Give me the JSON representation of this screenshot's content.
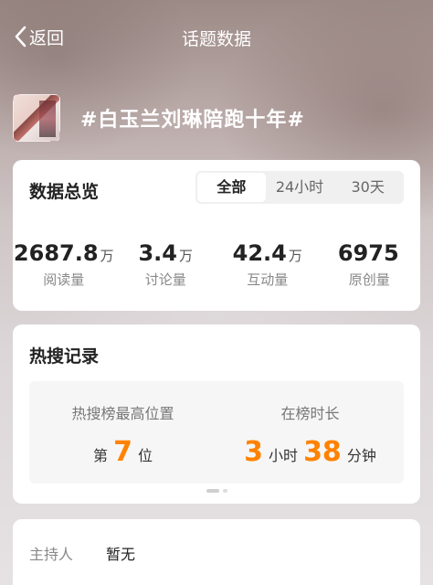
{
  "nav": {
    "back_label": "返回",
    "title": "话题数据"
  },
  "topic": {
    "title": "#白玉兰刘琳陪跑十年#"
  },
  "overview": {
    "title": "数据总览",
    "tabs": [
      "全部",
      "24小时",
      "30天"
    ],
    "active_tab": "全部",
    "stats": [
      {
        "value": "2687.8",
        "unit": "万",
        "label": "阅读量"
      },
      {
        "value": "3.4",
        "unit": "万",
        "label": "讨论量"
      },
      {
        "value": "42.4",
        "unit": "万",
        "label": "互动量"
      },
      {
        "value": "6975",
        "unit": "",
        "label": "原创量"
      }
    ]
  },
  "hot": {
    "title": "热搜记录",
    "highest": {
      "label": "热搜榜最高位置",
      "prefix": "第",
      "value": "7",
      "suffix": "位"
    },
    "duration": {
      "label": "在榜时长",
      "hours": "3",
      "hours_unit": "小时",
      "minutes": "38",
      "minutes_unit": "分钟"
    }
  },
  "info": {
    "host_label": "主持人",
    "host_value": "暂无"
  },
  "colors": {
    "accent": "#ff8200"
  }
}
